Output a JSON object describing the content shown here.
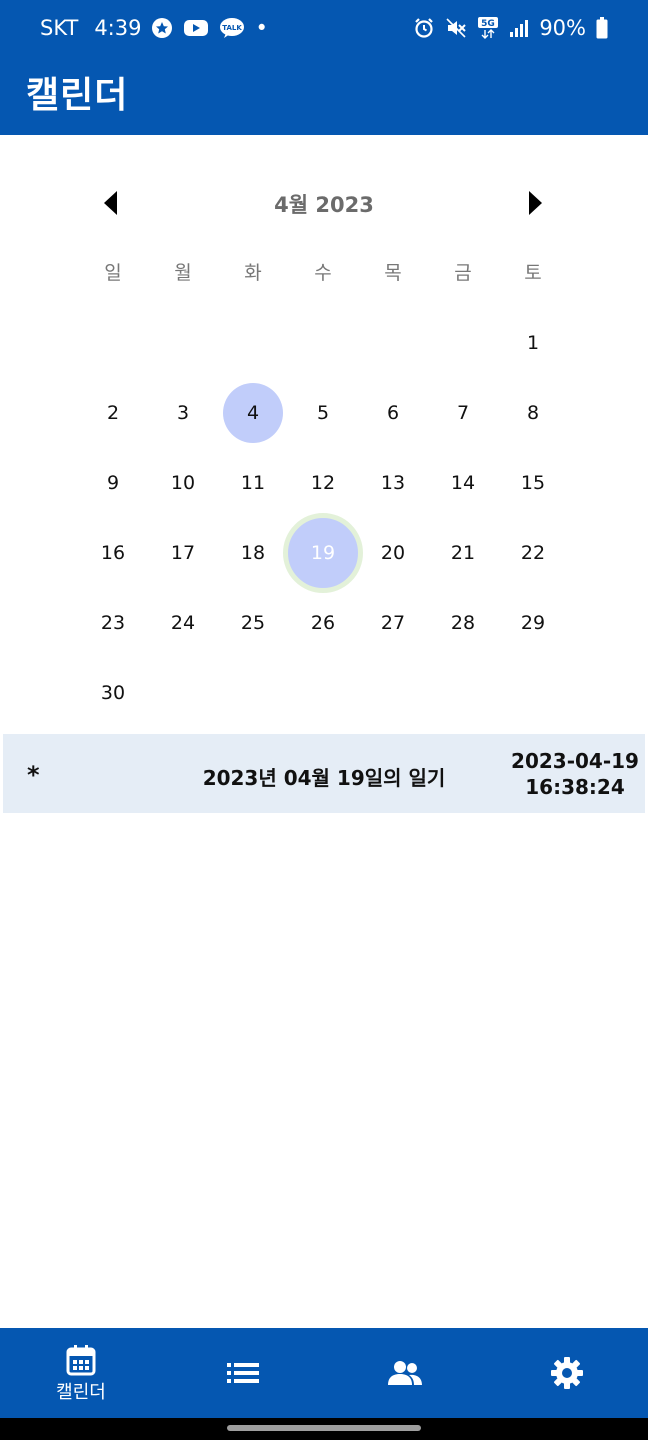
{
  "status_bar": {
    "carrier": "SKT",
    "time": "4:39",
    "dot": "•",
    "network": "5G",
    "battery": "90%",
    "notification_icons": [
      "navigation-star-icon",
      "youtube-icon",
      "kakaotalk-icon"
    ],
    "system_icons": [
      "alarm-icon",
      "mute-icon",
      "5g-icon",
      "signal-icon",
      "battery-icon"
    ]
  },
  "app_bar": {
    "title": "캘린더"
  },
  "calendar": {
    "month_label": "4월 2023",
    "weekdays": [
      "일",
      "월",
      "화",
      "수",
      "목",
      "금",
      "토"
    ],
    "first_weekday_index": 6,
    "days": [
      "1",
      "2",
      "3",
      "4",
      "5",
      "6",
      "7",
      "8",
      "9",
      "10",
      "11",
      "12",
      "13",
      "14",
      "15",
      "16",
      "17",
      "18",
      "19",
      "20",
      "21",
      "22",
      "23",
      "24",
      "25",
      "26",
      "27",
      "28",
      "29",
      "30"
    ],
    "today": "4",
    "selected": "19"
  },
  "entry": {
    "marker": "*",
    "title": "2023년 04월 19일의 일기",
    "date": "2023-04-19",
    "time": "16:38:24"
  },
  "bottom_nav": {
    "items": [
      {
        "label": "캘린더",
        "icon": "calendar-icon",
        "active": true
      },
      {
        "label": "",
        "icon": "list-icon",
        "active": false
      },
      {
        "label": "",
        "icon": "people-icon",
        "active": false
      },
      {
        "label": "",
        "icon": "gear-icon",
        "active": false
      }
    ]
  },
  "colors": {
    "primary": "#0557b1",
    "entry_bg": "#e5edf6",
    "day_highlight": "#c1cdfa",
    "selected_ring": "#e3f1d9"
  }
}
